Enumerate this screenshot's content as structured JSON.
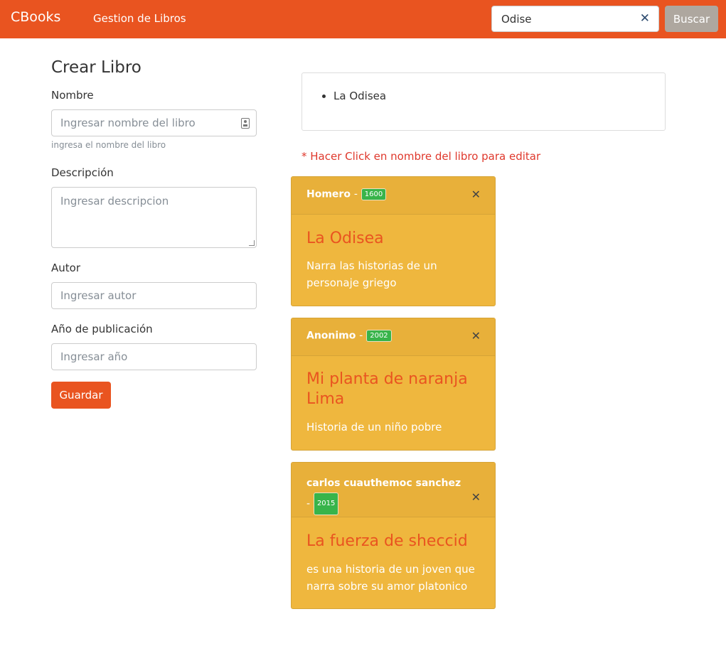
{
  "navbar": {
    "brand": "CBooks",
    "nav_link": "Gestion de Libros",
    "search_value": "Odise",
    "clear_icon": "close-icon",
    "search_button": "Buscar"
  },
  "form": {
    "title": "Crear Libro",
    "nombre_label": "Nombre",
    "nombre_placeholder": "Ingresar nombre del libro",
    "nombre_help": "ingresa el nombre del libro",
    "descripcion_label": "Descripción",
    "descripcion_placeholder": "Ingresar descripcion",
    "autor_label": "Autor",
    "autor_placeholder": "Ingresar autor",
    "anio_label": "Año de publicación",
    "anio_placeholder": "Ingresar año",
    "guardar_button": "Guardar"
  },
  "results": {
    "items": [
      "La Odisea"
    ]
  },
  "hint": "* Hacer Click en nombre del libro para editar",
  "books": [
    {
      "author": "Homero",
      "year": "1600",
      "title": "La Odisea",
      "description": "Narra las historias de un personaje griego"
    },
    {
      "author": "Anonimo",
      "year": "2002",
      "title": "Mi planta de naranja Lima",
      "description": "Historia de un niño pobre"
    },
    {
      "author": "carlos cuauthemoc sanchez",
      "year": "2015",
      "title": "La fuerza de sheccid",
      "description": "es una historia de un joven que narra sobre su amor platonico"
    }
  ],
  "colors": {
    "primary": "#e95420",
    "card": "#efb73e",
    "badge": "#38b44a",
    "secondary": "#aea79f"
  }
}
